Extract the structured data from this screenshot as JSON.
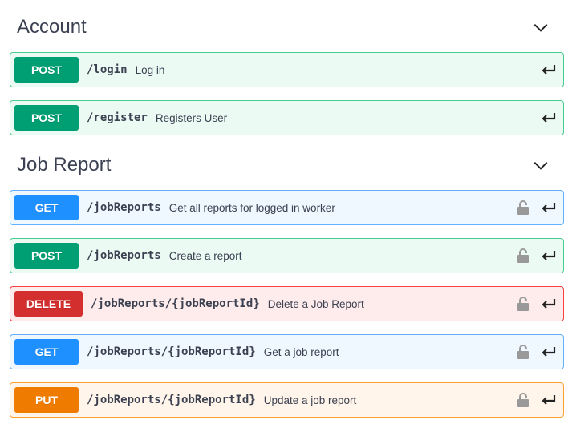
{
  "sections": [
    {
      "title": "Account",
      "operations": [
        {
          "method": "POST",
          "path": "/login",
          "summary": "Log in",
          "locked": false
        },
        {
          "method": "POST",
          "path": "/register",
          "summary": "Registers User",
          "locked": false
        }
      ]
    },
    {
      "title": "Job Report",
      "operations": [
        {
          "method": "GET",
          "path": "/jobReports",
          "summary": "Get all reports for logged in worker",
          "locked": true
        },
        {
          "method": "POST",
          "path": "/jobReports",
          "summary": "Create a report",
          "locked": true
        },
        {
          "method": "DELETE",
          "path": "/jobReports/{jobReportId}",
          "summary": "Delete a Job Report",
          "locked": true
        },
        {
          "method": "GET",
          "path": "/jobReports/{jobReportId}",
          "summary": "Get a job report",
          "locked": true
        },
        {
          "method": "PUT",
          "path": "/jobReports/{jobReportId}",
          "summary": "Update a job report",
          "locked": true
        }
      ]
    }
  ],
  "colors": {
    "post": "#009e73",
    "get": "#1e90ff",
    "delete": "#d32f2f",
    "put": "#ef7c00"
  },
  "icons": {
    "chevron": "chevron-down-icon",
    "lock": "lock-icon",
    "expand": "enter-arrow-icon"
  }
}
